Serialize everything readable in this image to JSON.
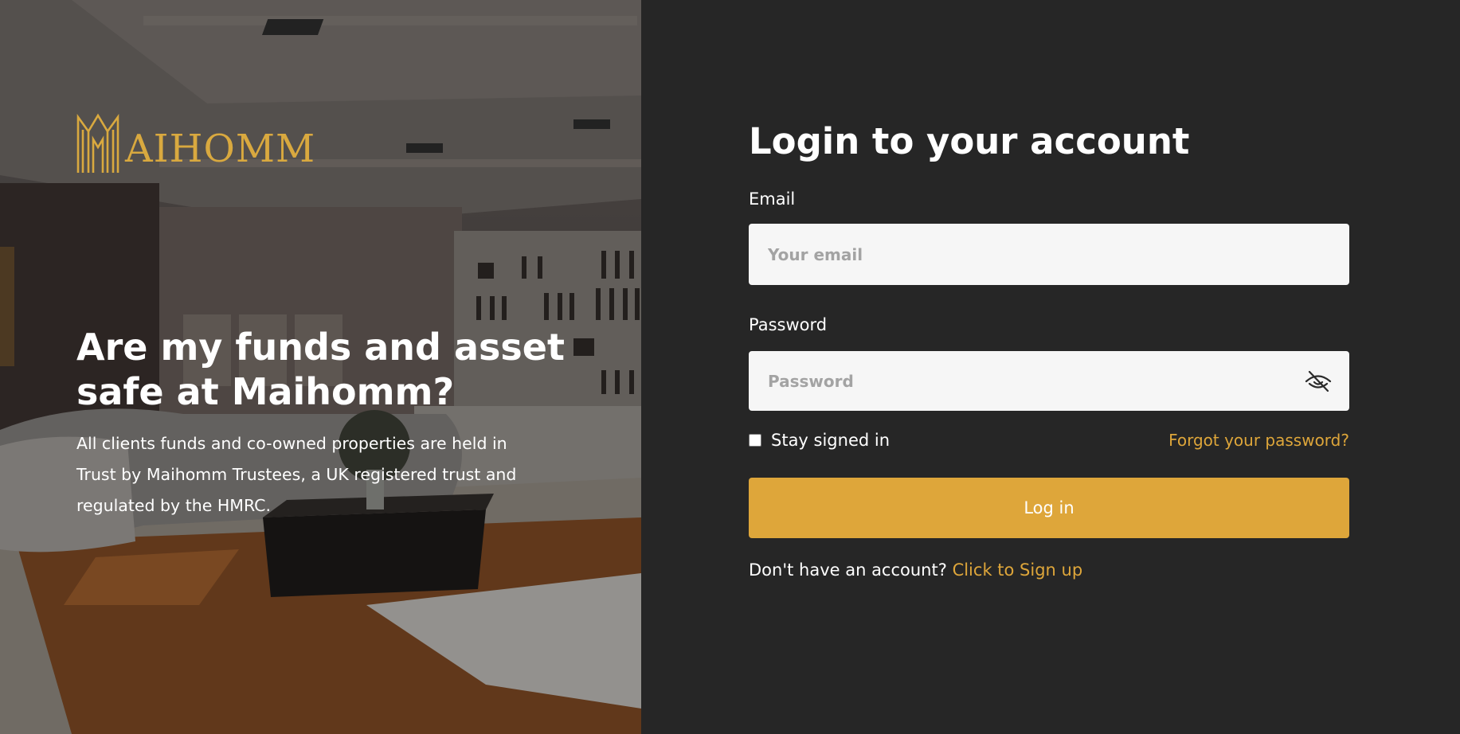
{
  "hero": {
    "logo_text": "AIHOMM",
    "headline": "Are my funds and asset safe at Maihomm?",
    "description": "All clients funds and co-owned properties are held in Trust by Maihomm Trustees, a UK registered trust and regulated by the HMRC."
  },
  "login": {
    "title": "Login to your account",
    "email_label": "Email",
    "email_placeholder": "Your email",
    "email_value": "",
    "password_label": "Password",
    "password_placeholder": "Password",
    "password_value": "",
    "stay_signed_in_label": "Stay signed in",
    "stay_signed_in_checked": false,
    "forgot_password": "Forgot your password?",
    "submit_label": "Log in",
    "signup_prompt": "Don't have an account?",
    "signup_link": "Click to Sign up"
  },
  "icons": {
    "password_toggle": "eye-slash-icon",
    "logo": "maihomm-logo-mark"
  },
  "colors": {
    "accent": "#dea63a",
    "panel_bg": "#262626",
    "input_bg": "#f6f6f6",
    "logo_gold": "#d9a93f"
  }
}
